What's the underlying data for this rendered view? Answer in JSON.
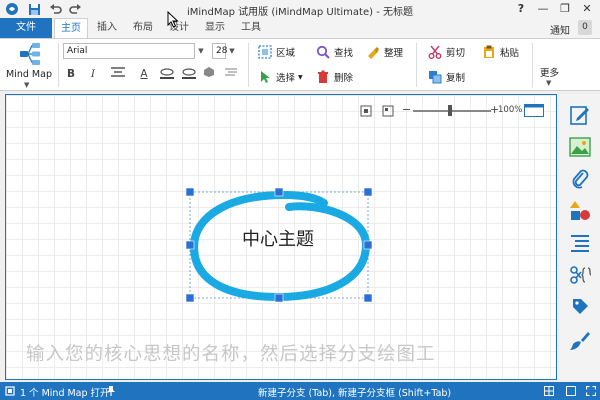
{
  "window": {
    "title": "iMindMap 试用版 (iMindMap Ultimate) - 无标题",
    "help": "?",
    "minimize": "—",
    "restore": "❐",
    "close": "✕"
  },
  "tabs": [
    {
      "label": "文件"
    },
    {
      "label": "主页"
    },
    {
      "label": "插入"
    },
    {
      "label": "布局"
    },
    {
      "label": "设计"
    },
    {
      "label": "显示"
    },
    {
      "label": "工具"
    }
  ],
  "notifications": {
    "label": "通知",
    "count": "0"
  },
  "ribbon": {
    "mindmap_label": "Mind Map",
    "font_name": "Arial",
    "font_size": "28",
    "bold": "B",
    "italic": "I",
    "text_color": "A",
    "commands": {
      "boundary": "区域",
      "find": "查找",
      "tidy": "整理",
      "cut": "剪切",
      "paste": "粘贴",
      "select": "选择",
      "delete": "删除",
      "copy": "复制"
    },
    "more_label": "更多"
  },
  "canvas": {
    "central_topic": "中心主题",
    "zoom_percent": "100%",
    "hint_text": "输入您的核心思想的名称，然后选择分支绘图工"
  },
  "statusbar": {
    "map_count": "1 个 Mind Map 打开",
    "shortcuts": "新建子分支 (Tab), 新建子分支框 (Shift+Tab)"
  },
  "colors": {
    "accent": "#1f73bf",
    "topic_ring": "#19a9e3"
  }
}
